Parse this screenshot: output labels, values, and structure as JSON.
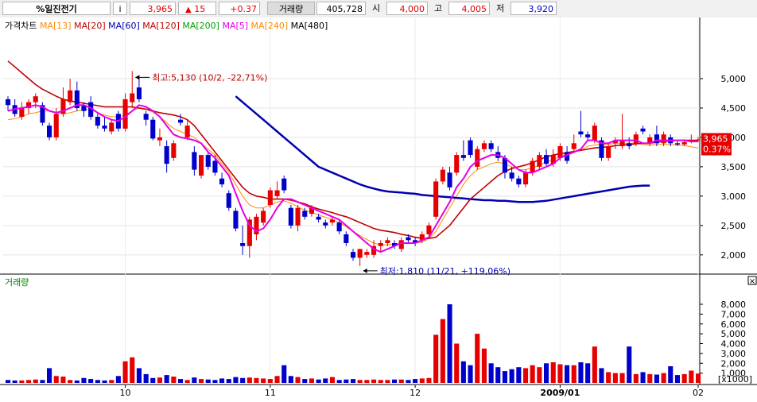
{
  "header": {
    "name": "%일진전기",
    "info_icon": "i",
    "price": "3,965",
    "change_arrow": "▲",
    "change": "15",
    "change_pct": "+0.37",
    "volume_label": "거래량",
    "volume": "405,728",
    "open_label": "시",
    "open": "4,000",
    "high_label": "고",
    "high": "4,005",
    "low_label": "저",
    "low": "3,920"
  },
  "colors": {
    "up": "#e60000",
    "down": "#0000cc",
    "ma5": "#e600e6",
    "ma20": "#c00000",
    "ma60": "#ff8c00",
    "ma120": "#0000b0",
    "vol_label": "#008000"
  },
  "chart_data": [
    {
      "type": "candlestick",
      "title": "가격차트",
      "legend": [
        {
          "label": "MA[13]",
          "color": "#ff8c00"
        },
        {
          "label": "MA[20]",
          "color": "#c00000"
        },
        {
          "label": "MA[60]",
          "color": "#0000b0"
        },
        {
          "label": "MA[120]",
          "color": "#c00000"
        },
        {
          "label": "MA[200]",
          "color": "#00a000"
        },
        {
          "label": "MA[5]",
          "color": "#e600e6"
        },
        {
          "label": "MA[240]",
          "color": "#ff8c00"
        },
        {
          "label": "MA[480]",
          "color": "#000000"
        }
      ],
      "ylim": [
        1700,
        5500
      ],
      "yticks": [
        {
          "v": 2000,
          "t": "2,000"
        },
        {
          "v": 2500,
          "t": "2,500"
        },
        {
          "v": 3000,
          "t": "3,000"
        },
        {
          "v": 3500,
          "t": "3,500"
        },
        {
          "v": 4000,
          "t": "4,000"
        },
        {
          "v": 4500,
          "t": "4,500"
        },
        {
          "v": 5000,
          "t": "5,000"
        }
      ],
      "xticks": [
        {
          "i": 17,
          "t": "10"
        },
        {
          "i": 38,
          "t": "11"
        },
        {
          "i": 59,
          "t": "12"
        },
        {
          "i": 80,
          "t": "2009/01"
        },
        {
          "i": 100,
          "t": "02"
        }
      ],
      "candles": [
        [
          4650,
          4700,
          4450,
          4550
        ],
        [
          4550,
          4650,
          4350,
          4400
        ],
        [
          4350,
          4600,
          4300,
          4500
        ],
        [
          4500,
          4650,
          4400,
          4600
        ],
        [
          4600,
          4750,
          4500,
          4700
        ],
        [
          4550,
          4600,
          4200,
          4250
        ],
        [
          4200,
          4250,
          3950,
          4000
        ],
        [
          4000,
          4500,
          3950,
          4400
        ],
        [
          4400,
          4850,
          4350,
          4650
        ],
        [
          4600,
          5000,
          4550,
          4800
        ],
        [
          4800,
          4950,
          4450,
          4500
        ],
        [
          4550,
          4600,
          4350,
          4450
        ],
        [
          4600,
          4700,
          4300,
          4350
        ],
        [
          4350,
          4400,
          4150,
          4200
        ],
        [
          4200,
          4350,
          4100,
          4150
        ],
        [
          4100,
          4300,
          4050,
          4250
        ],
        [
          4400,
          4450,
          4100,
          4150
        ],
        [
          4150,
          4750,
          4100,
          4650
        ],
        [
          4600,
          5130,
          4500,
          4750
        ],
        [
          4850,
          5050,
          4600,
          4650
        ],
        [
          4400,
          4450,
          4200,
          4300
        ],
        [
          4300,
          4350,
          3950,
          3980
        ],
        [
          3950,
          4150,
          3850,
          4000
        ],
        [
          3850,
          3950,
          3400,
          3550
        ],
        [
          3650,
          3950,
          3600,
          3900
        ],
        [
          4300,
          4400,
          4200,
          4250
        ],
        [
          4000,
          4300,
          3950,
          4200
        ],
        [
          3750,
          3850,
          3350,
          3450
        ],
        [
          3350,
          3700,
          3300,
          3700
        ],
        [
          3700,
          3750,
          3450,
          3500
        ],
        [
          3600,
          3700,
          3350,
          3400
        ],
        [
          3300,
          3400,
          3150,
          3200
        ],
        [
          3050,
          3100,
          2750,
          2800
        ],
        [
          2750,
          2800,
          2400,
          2450
        ],
        [
          2200,
          2500,
          2000,
          2150
        ],
        [
          2150,
          2650,
          1950,
          2600
        ],
        [
          2350,
          2700,
          2250,
          2650
        ],
        [
          2550,
          2800,
          2500,
          2750
        ],
        [
          2850,
          3150,
          2800,
          3100
        ],
        [
          3000,
          3250,
          2950,
          3100
        ],
        [
          3300,
          3350,
          3050,
          3100
        ],
        [
          2800,
          2850,
          2450,
          2500
        ],
        [
          2500,
          2850,
          2400,
          2800
        ],
        [
          2750,
          2800,
          2600,
          2650
        ],
        [
          2700,
          2850,
          2650,
          2800
        ],
        [
          2650,
          2700,
          2550,
          2600
        ],
        [
          2550,
          2600,
          2450,
          2500
        ],
        [
          2550,
          2650,
          2500,
          2600
        ],
        [
          2550,
          2600,
          2350,
          2400
        ],
        [
          2350,
          2400,
          2150,
          2200
        ],
        [
          2050,
          2100,
          1900,
          1950
        ],
        [
          1950,
          2100,
          1810,
          2100
        ],
        [
          2000,
          2100,
          1950,
          2050
        ],
        [
          2000,
          2250,
          1950,
          2150
        ],
        [
          2150,
          2250,
          2050,
          2200
        ],
        [
          2200,
          2300,
          2150,
          2250
        ],
        [
          2200,
          2250,
          2100,
          2150
        ],
        [
          2100,
          2300,
          2050,
          2250
        ],
        [
          2300,
          2350,
          2200,
          2250
        ],
        [
          2250,
          2300,
          2150,
          2200
        ],
        [
          2250,
          2400,
          2200,
          2350
        ],
        [
          2350,
          2550,
          2300,
          2500
        ],
        [
          2650,
          3300,
          2600,
          3250
        ],
        [
          3250,
          3500,
          3200,
          3450
        ],
        [
          3400,
          3500,
          3100,
          3150
        ],
        [
          3400,
          3750,
          3350,
          3700
        ],
        [
          3700,
          3950,
          3600,
          3650
        ],
        [
          3950,
          4000,
          3650,
          3700
        ],
        [
          3500,
          3850,
          3450,
          3800
        ],
        [
          3800,
          3950,
          3750,
          3900
        ],
        [
          3900,
          3950,
          3750,
          3800
        ],
        [
          3750,
          3850,
          3600,
          3650
        ],
        [
          3650,
          3700,
          3300,
          3400
        ],
        [
          3400,
          3500,
          3250,
          3300
        ],
        [
          3300,
          3350,
          3150,
          3200
        ],
        [
          3200,
          3450,
          3150,
          3400
        ],
        [
          3400,
          3650,
          3350,
          3600
        ],
        [
          3500,
          3750,
          3450,
          3700
        ],
        [
          3700,
          3800,
          3500,
          3550
        ],
        [
          3550,
          3800,
          3500,
          3700
        ],
        [
          3650,
          3900,
          3600,
          3850
        ],
        [
          3750,
          3850,
          3550,
          3600
        ],
        [
          3800,
          4050,
          3750,
          3900
        ],
        [
          4100,
          4450,
          4000,
          4050
        ],
        [
          4050,
          4100,
          3950,
          4000
        ],
        [
          3950,
          4250,
          3900,
          4200
        ],
        [
          3950,
          4000,
          3600,
          3650
        ],
        [
          3650,
          3900,
          3600,
          3850
        ],
        [
          3900,
          4000,
          3800,
          3950
        ],
        [
          3850,
          4400,
          3800,
          3950
        ],
        [
          3900,
          4000,
          3800,
          3850
        ],
        [
          3900,
          4100,
          3850,
          4050
        ],
        [
          4150,
          4200,
          4050,
          4100
        ],
        [
          3900,
          4050,
          3850,
          4000
        ],
        [
          4050,
          4200,
          3850,
          3900
        ],
        [
          3900,
          4100,
          3850,
          4050
        ],
        [
          4000,
          4050,
          3850,
          3900
        ],
        [
          3900,
          3950,
          3850,
          3880
        ],
        [
          3880,
          3950,
          3850,
          3920
        ],
        [
          3950,
          4050,
          3900,
          3950
        ],
        [
          3950,
          4005,
          3920,
          3965
        ]
      ],
      "ma5": [
        4450,
        4480,
        4500,
        4520,
        4550,
        4520,
        4450,
        4420,
        4450,
        4500,
        4550,
        4550,
        4500,
        4420,
        4350,
        4300,
        4280,
        4350,
        4450,
        4550,
        4520,
        4450,
        4350,
        4200,
        4050,
        4000,
        3980,
        3950,
        3900,
        3750,
        3650,
        3500,
        3350,
        3050,
        2750,
        2500,
        2400,
        2450,
        2600,
        2800,
        2950,
        2950,
        2900,
        2850,
        2800,
        2750,
        2700,
        2650,
        2600,
        2500,
        2400,
        2300,
        2200,
        2100,
        2050,
        2100,
        2150,
        2200,
        2200,
        2200,
        2250,
        2300,
        2500,
        2700,
        2900,
        3150,
        3300,
        3500,
        3600,
        3650,
        3700,
        3700,
        3650,
        3550,
        3450,
        3400,
        3400,
        3450,
        3500,
        3550,
        3650,
        3700,
        3750,
        3800,
        3950,
        3950,
        3900,
        3900,
        3950,
        3950,
        3950,
        3950,
        3900,
        3900,
        3950,
        3950,
        3950,
        3950,
        3950,
        3930,
        3930
      ],
      "ma20": [
        5300,
        5200,
        5100,
        5000,
        4900,
        4820,
        4760,
        4700,
        4650,
        4620,
        4600,
        4580,
        4560,
        4540,
        4520,
        4520,
        4520,
        4520,
        4520,
        4500,
        4480,
        4450,
        4420,
        4400,
        4380,
        4350,
        4300,
        4200,
        4050,
        3900,
        3750,
        3600,
        3450,
        3300,
        3150,
        3050,
        3000,
        2980,
        2950,
        2950,
        2950,
        2930,
        2900,
        2870,
        2820,
        2780,
        2750,
        2720,
        2680,
        2650,
        2600,
        2550,
        2500,
        2450,
        2420,
        2400,
        2380,
        2350,
        2330,
        2300,
        2280,
        2280,
        2300,
        2400,
        2500,
        2650,
        2800,
        2950,
        3050,
        3150,
        3250,
        3350,
        3420,
        3470,
        3500,
        3530,
        3570,
        3620,
        3670,
        3700,
        3720,
        3740,
        3760,
        3780,
        3800,
        3820,
        3830,
        3840,
        3860,
        3870,
        3880,
        3890,
        3900,
        3900,
        3920,
        3930,
        3940,
        3950,
        3950,
        3950,
        3950
      ],
      "ma60": [
        null,
        null,
        null,
        null,
        null,
        null,
        null,
        null,
        null,
        null,
        null,
        null,
        null,
        null,
        null,
        null,
        null,
        null,
        null,
        null,
        null,
        null,
        null,
        null,
        null,
        null,
        null,
        null,
        null,
        null,
        null,
        null,
        null,
        4700,
        4600,
        4500,
        4400,
        4300,
        4200,
        4100,
        4000,
        3900,
        3800,
        3700,
        3600,
        3500,
        3450,
        3400,
        3350,
        3300,
        3250,
        3200,
        3160,
        3130,
        3100,
        3080,
        3070,
        3060,
        3050,
        3040,
        3020,
        3010,
        3000,
        2990,
        2980,
        2970,
        2960,
        2950,
        2940,
        2930,
        2930,
        2920,
        2920,
        2910,
        2900,
        2900,
        2900,
        2910,
        2920,
        2940,
        2960,
        2980,
        3000,
        3020,
        3040,
        3060,
        3080,
        3100,
        3120,
        3140,
        3160,
        3170,
        3180,
        3180
      ],
      "ma_thin": [
        4300,
        4320,
        4350,
        4400,
        4420,
        4450,
        4450,
        4420,
        4400,
        4420,
        4450,
        4480,
        4470,
        4420,
        4380,
        4350,
        4350,
        4380,
        4450,
        4500,
        4480,
        4430,
        4350,
        4250,
        4150,
        4100,
        4050,
        4000,
        3900,
        3800,
        3700,
        3550,
        3400,
        3200,
        3000,
        2850,
        2800,
        2800,
        2850,
        2900,
        2920,
        2880,
        2820,
        2760,
        2720,
        2680,
        2640,
        2600,
        2550,
        2480,
        2400,
        2330,
        2260,
        2200,
        2170,
        2170,
        2190,
        2200,
        2200,
        2200,
        2220,
        2280,
        2400,
        2600,
        2800,
        3000,
        3200,
        3350,
        3450,
        3500,
        3550,
        3580,
        3550,
        3500,
        3450,
        3450,
        3480,
        3530,
        3580,
        3620,
        3680,
        3720,
        3750,
        3780,
        3850,
        3870,
        3880,
        3880,
        3900,
        3900,
        3900,
        3900,
        3880,
        3870,
        3880,
        3880,
        3880,
        3870,
        3860,
        3840,
        3820
      ],
      "annotations": [
        {
          "i": 18,
          "v": 5130,
          "text": "최고:5,130 (10/2, -22,71%)"
        },
        {
          "i": 51,
          "v": 1810,
          "text": "최저:1,810 (11/21, +119,06%)"
        }
      ],
      "last_price_label": "3,965",
      "last_change_label": "0.37%"
    },
    {
      "type": "bar",
      "title": "거래량",
      "unit_label": "[x1000]",
      "ylim": [
        0,
        8800
      ],
      "yticks": [
        {
          "v": 1000,
          "t": "1,000"
        },
        {
          "v": 2000,
          "t": "2,000"
        },
        {
          "v": 3000,
          "t": "3,000"
        },
        {
          "v": 4000,
          "t": "4,000"
        },
        {
          "v": 5000,
          "t": "5,000"
        },
        {
          "v": 6000,
          "t": "6,000"
        },
        {
          "v": 7000,
          "t": "7,000"
        },
        {
          "v": 8000,
          "t": "8,000"
        }
      ],
      "values": [
        300,
        250,
        250,
        300,
        350,
        300,
        1500,
        700,
        650,
        300,
        250,
        500,
        400,
        300,
        250,
        300,
        700,
        2200,
        2600,
        1500,
        900,
        500,
        550,
        800,
        650,
        400,
        300,
        550,
        400,
        350,
        300,
        450,
        400,
        600,
        500,
        550,
        500,
        450,
        400,
        700,
        1800,
        700,
        600,
        400,
        450,
        350,
        450,
        600,
        300,
        350,
        400,
        300,
        300,
        350,
        300,
        300,
        350,
        350,
        300,
        400,
        450,
        500,
        4900,
        6500,
        8000,
        4000,
        2200,
        1800,
        5000,
        3500,
        2000,
        1600,
        1200,
        1400,
        1600,
        1500,
        1800,
        1600,
        2000,
        2100,
        1900,
        1800,
        1800,
        2100,
        2000,
        3700,
        1500,
        1100,
        1000,
        1000,
        3700,
        900,
        1100,
        900,
        850,
        1000,
        1700,
        800,
        900,
        1250,
        950
      ]
    }
  ],
  "close_icon": "×"
}
